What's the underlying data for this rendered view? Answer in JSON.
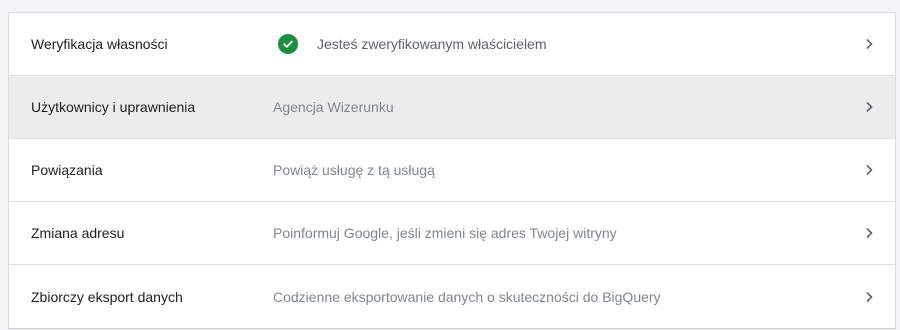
{
  "settings": {
    "rows": [
      {
        "label": "Weryfikacja własności",
        "value": "Jesteś zweryfikowanym właścicielem",
        "value_icon": "check-circle-icon",
        "value_icon_color": "#1e8e3e",
        "highlighted": false
      },
      {
        "label": "Użytkownicy i uprawnienia",
        "value": "Agencja Wizerunku",
        "highlighted": true
      },
      {
        "label": "Powiązania",
        "value": "Powiąż usługę z tą usługą",
        "highlighted": false
      },
      {
        "label": "Zmiana adresu",
        "value": "Poinformuj Google, jeśli zmieni się adres Twojej witryny",
        "highlighted": false
      },
      {
        "label": "Zbiorczy eksport danych",
        "value": "Codzienne eksportowanie danych o skuteczności do BigQuery",
        "highlighted": false
      }
    ],
    "row_action_icon": "chevron-right-icon"
  }
}
